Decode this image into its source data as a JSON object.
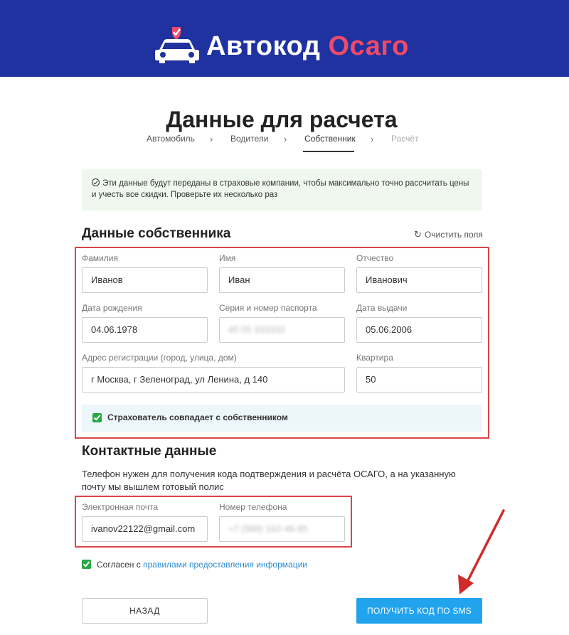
{
  "brand": {
    "name_white": "Автокод",
    "name_red": "Осаго",
    "color_header": "#1f32a0",
    "color_accent": "#ef4a6a"
  },
  "page": {
    "title": "Данные для расчета"
  },
  "steps": [
    {
      "label": "Автомобиль"
    },
    {
      "label": "Водители"
    },
    {
      "label": "Собственник",
      "active": true
    },
    {
      "label": "Расчёт"
    }
  ],
  "info": {
    "text": "Эти данные будут переданы в страховые компании, чтобы максимально точно рассчитать цены и учесть все скидки. Проверьте их несколько раз"
  },
  "owner": {
    "title": "Данные собственника",
    "clear_label": "Очистить поля",
    "last_name": {
      "label": "Фамилия",
      "value": "Иванов"
    },
    "first_name": {
      "label": "Имя",
      "value": "Иван"
    },
    "middle_name": {
      "label": "Отчество",
      "value": "Иванович"
    },
    "birth_date": {
      "label": "Дата рождения",
      "value": "04.06.1978"
    },
    "passport": {
      "label": "Серия и номер паспорта",
      "value": "45 05 333333"
    },
    "issue_date": {
      "label": "Дата выдачи",
      "value": "05.06.2006"
    },
    "address": {
      "label": "Адрес регистрации (город, улица, дом)",
      "value": "г Москва, г Зеленоград, ул Ленина, д 140"
    },
    "apartment": {
      "label": "Квартира",
      "value": "50"
    },
    "match_label": "Страхователь совпадает с собственником"
  },
  "contacts": {
    "title": "Контактные данные",
    "description": "Телефон нужен для получения кода подтверждения и расчёта ОСАГО, а на указанную почту мы вышлем готовый полис",
    "email": {
      "label": "Электронная почта",
      "value": "ivanov22122@gmail.com"
    },
    "phone": {
      "label": "Номер телефона",
      "value": "+7 (999) 162-46-95"
    }
  },
  "agree": {
    "prefix": "Согласен с",
    "link": "правилами предоставления информации"
  },
  "buttons": {
    "back": "НАЗАД",
    "sms": "ПОЛУЧИТЬ КОД ПО SMS"
  }
}
